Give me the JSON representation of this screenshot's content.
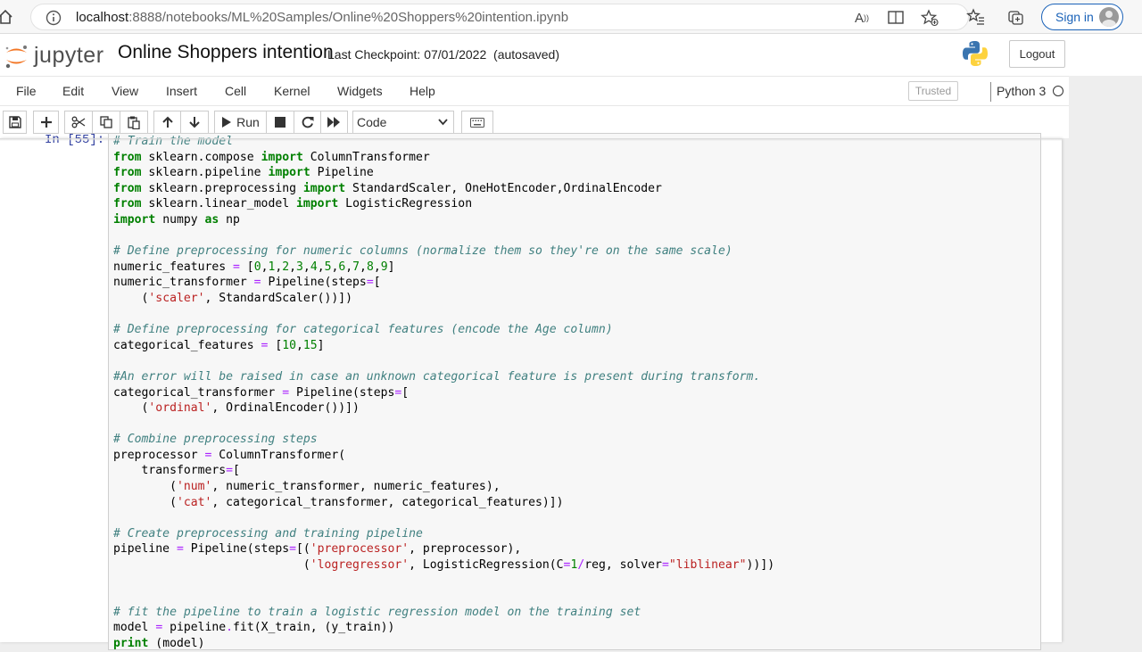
{
  "browser": {
    "url_host": "localhost",
    "url_path": ":8888/notebooks/ML%20Samples/Online%20Shoppers%20intention.ipynb",
    "signin_label": "Sign in"
  },
  "jupyter": {
    "logo_text": "jupyter",
    "notebook_title": "Online Shoppers intention",
    "checkpoint_label": "Last Checkpoint:",
    "checkpoint_date": "07/01/2022",
    "autosave": "(autosaved)",
    "logout_label": "Logout"
  },
  "menu": {
    "items": [
      "File",
      "Edit",
      "View",
      "Insert",
      "Cell",
      "Kernel",
      "Widgets",
      "Help"
    ],
    "trusted": "Trusted",
    "kernel": "Python 3"
  },
  "toolbar": {
    "run_label": "Run",
    "cell_type": "Code"
  },
  "cell": {
    "prompt": "In [55]:",
    "lines": [
      [
        [
          "cm",
          "# Train the model"
        ]
      ],
      [
        [
          "kw",
          "from"
        ],
        [
          "",
          " sklearn.compose "
        ],
        [
          "kw",
          "import"
        ],
        [
          "",
          " ColumnTransformer"
        ]
      ],
      [
        [
          "kw",
          "from"
        ],
        [
          "",
          " sklearn.pipeline "
        ],
        [
          "kw",
          "import"
        ],
        [
          "",
          " Pipeline"
        ]
      ],
      [
        [
          "kw",
          "from"
        ],
        [
          "",
          " sklearn.preprocessing "
        ],
        [
          "kw",
          "import"
        ],
        [
          "",
          " StandardScaler, OneHotEncoder,OrdinalEncoder"
        ]
      ],
      [
        [
          "kw",
          "from"
        ],
        [
          "",
          " sklearn.linear_model "
        ],
        [
          "kw",
          "import"
        ],
        [
          "",
          " LogisticRegression"
        ]
      ],
      [
        [
          "kw",
          "import"
        ],
        [
          "",
          " numpy "
        ],
        [
          "kw",
          "as"
        ],
        [
          "",
          " np"
        ]
      ],
      [],
      [
        [
          "cm",
          "# Define preprocessing for numeric columns (normalize them so they're on the same scale)"
        ]
      ],
      [
        [
          "",
          "numeric_features "
        ],
        [
          "op",
          "="
        ],
        [
          "",
          " ["
        ],
        [
          "nu",
          "0"
        ],
        [
          "",
          ","
        ],
        [
          "nu",
          "1"
        ],
        [
          "",
          ","
        ],
        [
          "nu",
          "2"
        ],
        [
          "",
          ","
        ],
        [
          "nu",
          "3"
        ],
        [
          "",
          ","
        ],
        [
          "nu",
          "4"
        ],
        [
          "",
          ","
        ],
        [
          "nu",
          "5"
        ],
        [
          "",
          ","
        ],
        [
          "nu",
          "6"
        ],
        [
          "",
          ","
        ],
        [
          "nu",
          "7"
        ],
        [
          "",
          ","
        ],
        [
          "nu",
          "8"
        ],
        [
          "",
          ","
        ],
        [
          "nu",
          "9"
        ],
        [
          "",
          "]"
        ]
      ],
      [
        [
          "",
          "numeric_transformer "
        ],
        [
          "op",
          "="
        ],
        [
          "",
          " Pipeline(steps"
        ],
        [
          "op",
          "="
        ],
        [
          "",
          "["
        ]
      ],
      [
        [
          "",
          "    ("
        ],
        [
          "st",
          "'scaler'"
        ],
        [
          "",
          ", StandardScaler())])"
        ]
      ],
      [],
      [
        [
          "cm",
          "# Define preprocessing for categorical features (encode the Age column)"
        ]
      ],
      [
        [
          "",
          "categorical_features "
        ],
        [
          "op",
          "="
        ],
        [
          "",
          " ["
        ],
        [
          "nu",
          "10"
        ],
        [
          "",
          ","
        ],
        [
          "nu",
          "15"
        ],
        [
          "",
          "]"
        ]
      ],
      [],
      [
        [
          "cm",
          "#An error will be raised in case an unknown categorical feature is present during transform."
        ]
      ],
      [
        [
          "",
          "categorical_transformer "
        ],
        [
          "op",
          "="
        ],
        [
          "",
          " Pipeline(steps"
        ],
        [
          "op",
          "="
        ],
        [
          "",
          "["
        ]
      ],
      [
        [
          "",
          "    ("
        ],
        [
          "st",
          "'ordinal'"
        ],
        [
          "",
          ", OrdinalEncoder())])"
        ]
      ],
      [],
      [
        [
          "cm",
          "# Combine preprocessing steps"
        ]
      ],
      [
        [
          "",
          "preprocessor "
        ],
        [
          "op",
          "="
        ],
        [
          "",
          " ColumnTransformer("
        ]
      ],
      [
        [
          "",
          "    transformers"
        ],
        [
          "op",
          "="
        ],
        [
          "",
          "["
        ]
      ],
      [
        [
          "",
          "        ("
        ],
        [
          "st",
          "'num'"
        ],
        [
          "",
          ", numeric_transformer, numeric_features),"
        ]
      ],
      [
        [
          "",
          "        ("
        ],
        [
          "st",
          "'cat'"
        ],
        [
          "",
          ", categorical_transformer, categorical_features)])"
        ]
      ],
      [],
      [
        [
          "cm",
          "# Create preprocessing and training pipeline"
        ]
      ],
      [
        [
          "",
          "pipeline "
        ],
        [
          "op",
          "="
        ],
        [
          "",
          " Pipeline(steps"
        ],
        [
          "op",
          "="
        ],
        [
          "",
          "[("
        ],
        [
          "st",
          "'preprocessor'"
        ],
        [
          "",
          ", preprocessor),"
        ]
      ],
      [
        [
          "",
          "                           ("
        ],
        [
          "st",
          "'logregressor'"
        ],
        [
          "",
          ", LogisticRegression(C"
        ],
        [
          "op",
          "="
        ],
        [
          "nu",
          "1"
        ],
        [
          "op",
          "/"
        ],
        [
          "",
          "reg, solver"
        ],
        [
          "op",
          "="
        ],
        [
          "st",
          "\"liblinear\""
        ],
        [
          "",
          "))])"
        ]
      ],
      [],
      [],
      [
        [
          "cm",
          "# fit the pipeline to train a logistic regression model on the training set"
        ]
      ],
      [
        [
          "",
          "model "
        ],
        [
          "op",
          "="
        ],
        [
          "",
          " pipeline"
        ],
        [
          "op",
          "."
        ],
        [
          "",
          "fit(X_train, (y_train))"
        ]
      ],
      [
        [
          "kw",
          "print"
        ],
        [
          "",
          " (model)"
        ]
      ]
    ]
  }
}
